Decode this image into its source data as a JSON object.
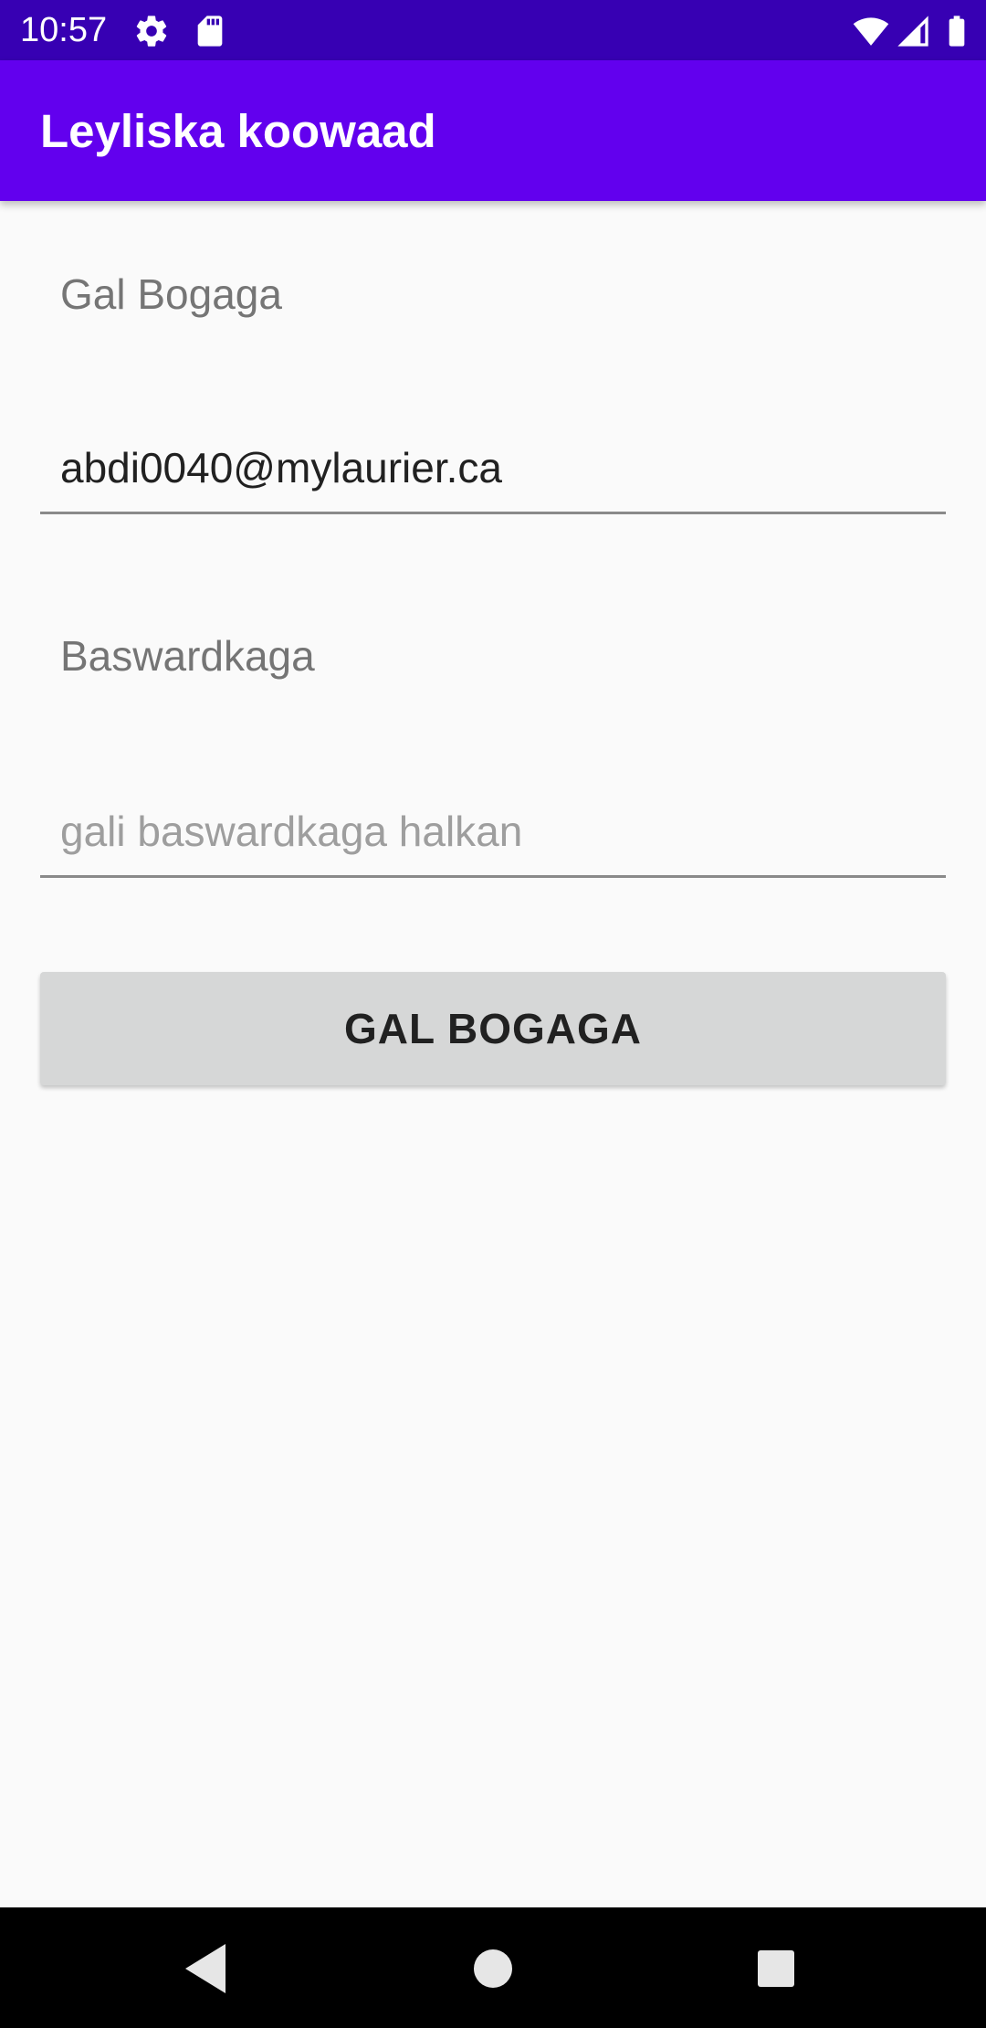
{
  "status_bar": {
    "time": "10:57",
    "icons": [
      "settings-icon",
      "sd-card-icon",
      "wifi-icon",
      "signal-icon",
      "battery-icon"
    ]
  },
  "app_bar": {
    "title": "Leyliska koowaad"
  },
  "form": {
    "email_label": "Gal Bogaga",
    "email_value": "abdi0040@mylaurier.ca",
    "password_label": "Baswardkaga",
    "password_placeholder": "gali baswardkaga halkan",
    "login_button": "GAL BOGAGA"
  },
  "nav_bar": {
    "buttons": [
      "back-icon",
      "home-icon",
      "recents-icon"
    ]
  },
  "colors": {
    "status_bar": "#3700b3",
    "app_bar": "#6200ee",
    "background": "#fafafa",
    "button": "#d6d7d7"
  }
}
